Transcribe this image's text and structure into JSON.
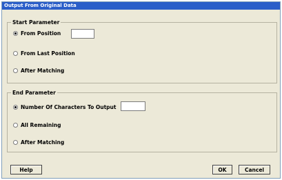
{
  "window": {
    "title": "Output From Original Data"
  },
  "start_group": {
    "legend": "Start Parameter",
    "options": [
      {
        "label": "From Position",
        "selected": true
      },
      {
        "label": "From Last Position",
        "selected": false
      },
      {
        "label": "After Matching",
        "selected": false
      }
    ],
    "position_value": ""
  },
  "end_group": {
    "legend": "End Parameter",
    "options": [
      {
        "label": "Number Of Characters To Output",
        "selected": true
      },
      {
        "label": "All Remaining",
        "selected": false
      },
      {
        "label": "After Matching",
        "selected": false
      }
    ],
    "count_value": ""
  },
  "buttons": {
    "help": "Help",
    "ok": "OK",
    "cancel": "Cancel"
  },
  "colors": {
    "title_bar": "#2a5ec9",
    "dialog_background": "#ece9d8"
  }
}
